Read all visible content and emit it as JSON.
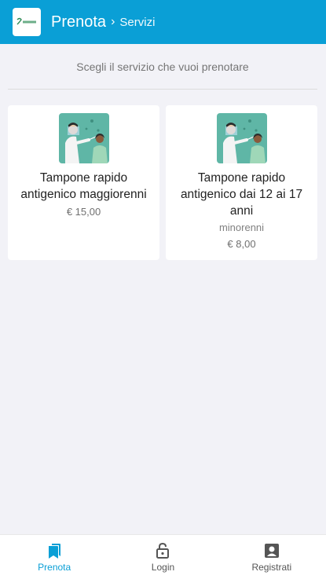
{
  "header": {
    "title": "Prenota",
    "separator": "›",
    "subtitle": "Servizi"
  },
  "page": {
    "instruction": "Scegli il servizio che vuoi prenotare"
  },
  "services": [
    {
      "title": "Tampone rapido antigenico maggiorenni",
      "note": "",
      "price": "€ 15,00",
      "image_icon": "covid-test-illustration"
    },
    {
      "title": "Tampone rapido antigenico dai 12 ai 17 anni",
      "note": "minorenni",
      "price": "€ 8,00",
      "image_icon": "covid-test-illustration"
    }
  ],
  "bottom_nav": {
    "items": [
      {
        "label": "Prenota",
        "icon": "bookmark-icon",
        "active": true
      },
      {
        "label": "Login",
        "icon": "lock-icon",
        "active": false
      },
      {
        "label": "Registrati",
        "icon": "account-box-icon",
        "active": false
      }
    ]
  },
  "colors": {
    "primary": "#0a9fd6",
    "background": "#f2f2f7",
    "illustration_bg": "#5fb6a6"
  }
}
